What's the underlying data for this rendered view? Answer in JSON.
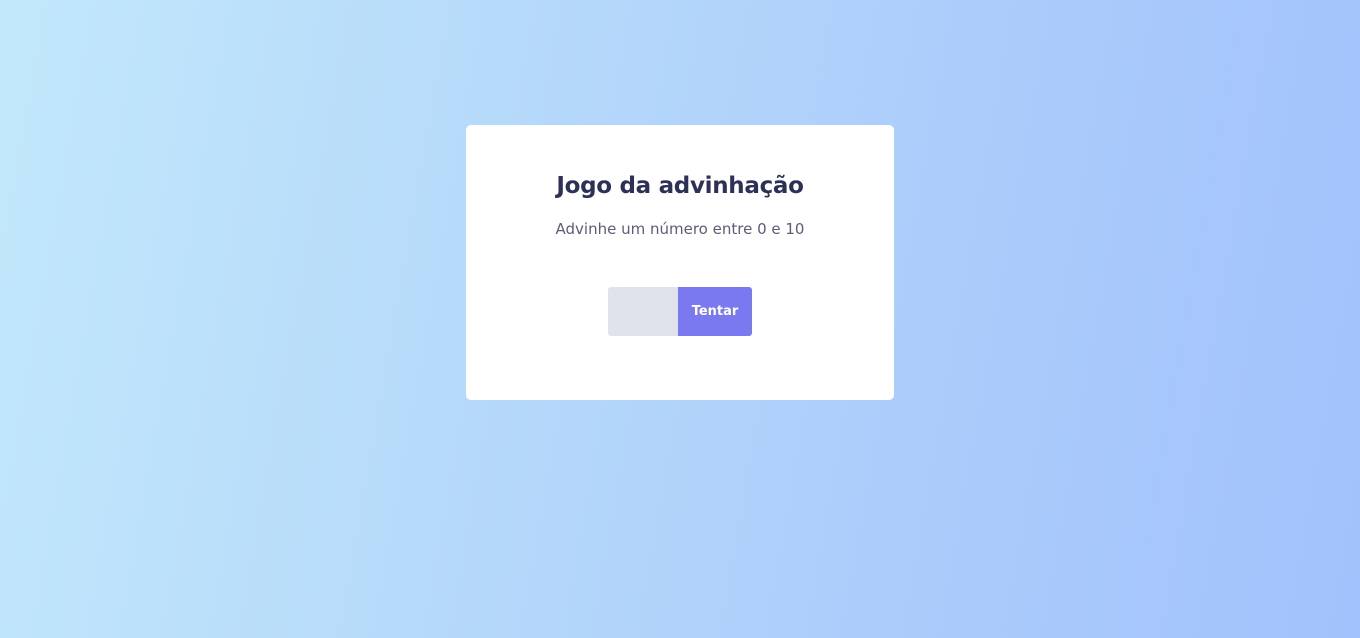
{
  "game": {
    "title": "Jogo da advinhação",
    "subtitle": "Advinhe um número entre 0 e 10",
    "input_value": "",
    "button_label": "Tentar"
  },
  "colors": {
    "background_start": "#c2e8fb",
    "background_end": "#a1c2fc",
    "card": "#ffffff",
    "title_text": "#2e3157",
    "subtitle_text": "#5b5d78",
    "input_background": "#dfe4ec",
    "button_background": "#7b79f0",
    "button_text": "#ffffff"
  }
}
